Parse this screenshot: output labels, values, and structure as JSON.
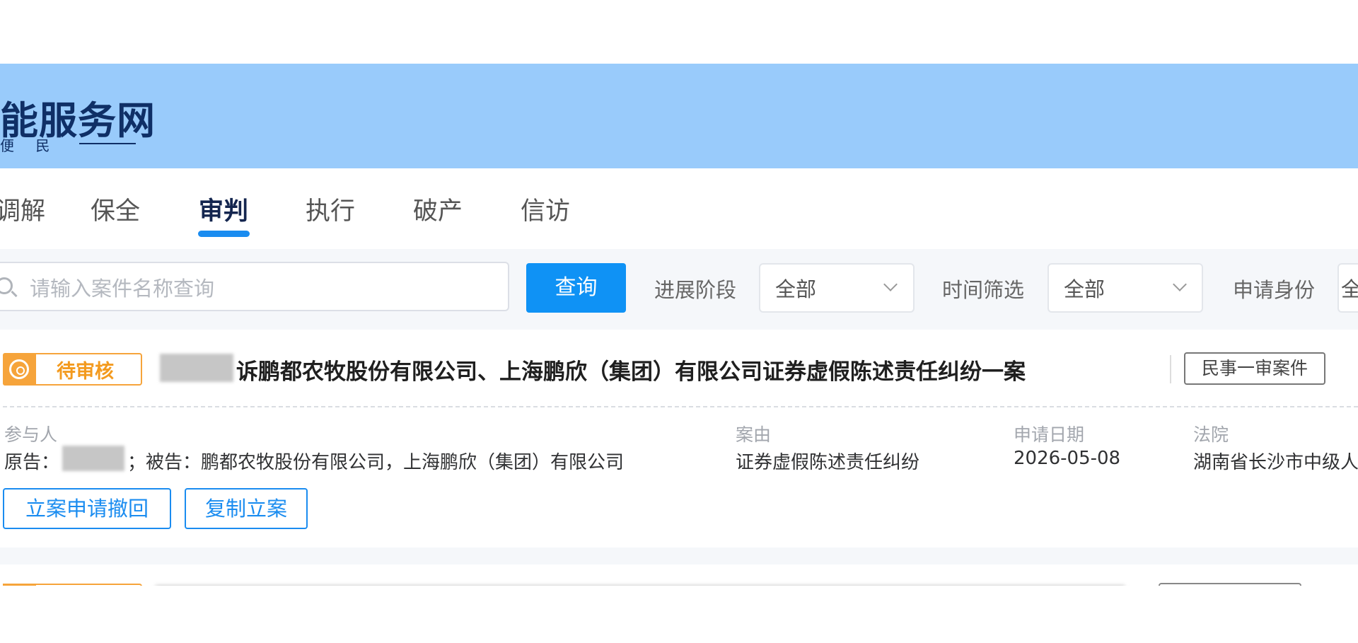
{
  "header": {
    "site_title": "能服务网",
    "slogan": "便 民"
  },
  "tabs": [
    {
      "label": "调解",
      "active": false
    },
    {
      "label": "保全",
      "active": false
    },
    {
      "label": "审判",
      "active": true
    },
    {
      "label": "执行",
      "active": false
    },
    {
      "label": "破产",
      "active": false
    },
    {
      "label": "信访",
      "active": false
    }
  ],
  "filters": {
    "search_placeholder": "请输入案件名称查询",
    "query_button": "查询",
    "progress_label": "进展阶段",
    "progress_value": "全部",
    "time_label": "时间筛选",
    "time_value": "全部",
    "identity_label": "申请身份",
    "identity_value": "全"
  },
  "cases": [
    {
      "status": "待审核",
      "title": "诉鹏都农牧股份有限公司、上海鹏欣（集团）有限公司证券虚假陈述责任纠纷一案",
      "case_type": "民事一审案件",
      "labels": {
        "participants": "参与人",
        "cause": "案由",
        "date": "申请日期",
        "court": "法院"
      },
      "participants_prefix": "原告：",
      "participants_rest": "；被告：鹏都农牧股份有限公司，上海鹏欣（集团）有限公司",
      "cause": "证券虚假陈述责任纠纷",
      "date": "2026-05-08",
      "court": "湖南省长沙市中级人",
      "actions": {
        "withdraw": "立案申请撤回",
        "copy": "复制立案"
      }
    }
  ],
  "colors": {
    "header_band": "#99cbfb",
    "primary": "#0f92f5",
    "pending": "#f6a43b"
  }
}
